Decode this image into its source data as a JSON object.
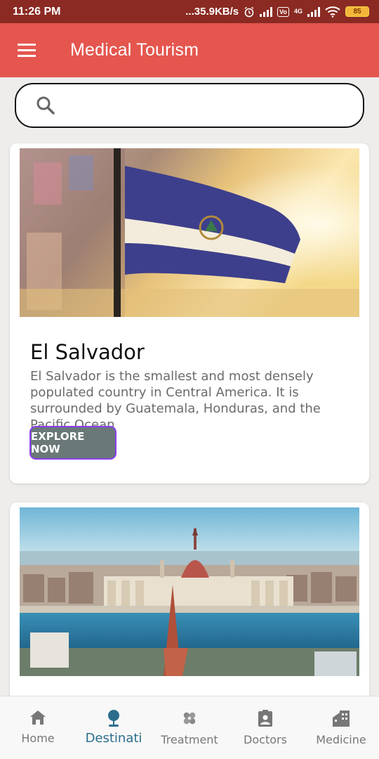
{
  "status_bar": {
    "time": "11:26 PM",
    "net_speed": "...35.9KB/s",
    "volte": "Vo",
    "net_type": "4G",
    "battery": "85"
  },
  "app_bar": {
    "title": "Medical Tourism",
    "menu_icon": "menu-icon"
  },
  "search": {
    "placeholder": "",
    "value": ""
  },
  "destinations": [
    {
      "title": "El Salvador",
      "description": "El Salvador is the smallest and most densely populated country in Central America. It is surrounded by Guatemala, Honduras, and the Pacific Ocean",
      "button": "EXPLORE NOW",
      "image": "el-salvador-flag"
    },
    {
      "title": "",
      "description": "",
      "button": "",
      "image": "budapest-parliament"
    }
  ],
  "bottom_nav": {
    "items": [
      {
        "label": "Home",
        "icon": "home-icon"
      },
      {
        "label": "Destinati",
        "icon": "pin-icon",
        "active": true
      },
      {
        "label": "Treatment",
        "icon": "bandage-icon"
      },
      {
        "label": "Doctors",
        "icon": "doctor-badge-icon"
      },
      {
        "label": "Medicine",
        "icon": "building-icon"
      }
    ]
  },
  "colors": {
    "app_bar": "#e4564e",
    "status_bar": "#8a2a23",
    "button": "#6a7878",
    "button_border": "#8b3ff0",
    "nav_active": "#2b6e8c"
  }
}
